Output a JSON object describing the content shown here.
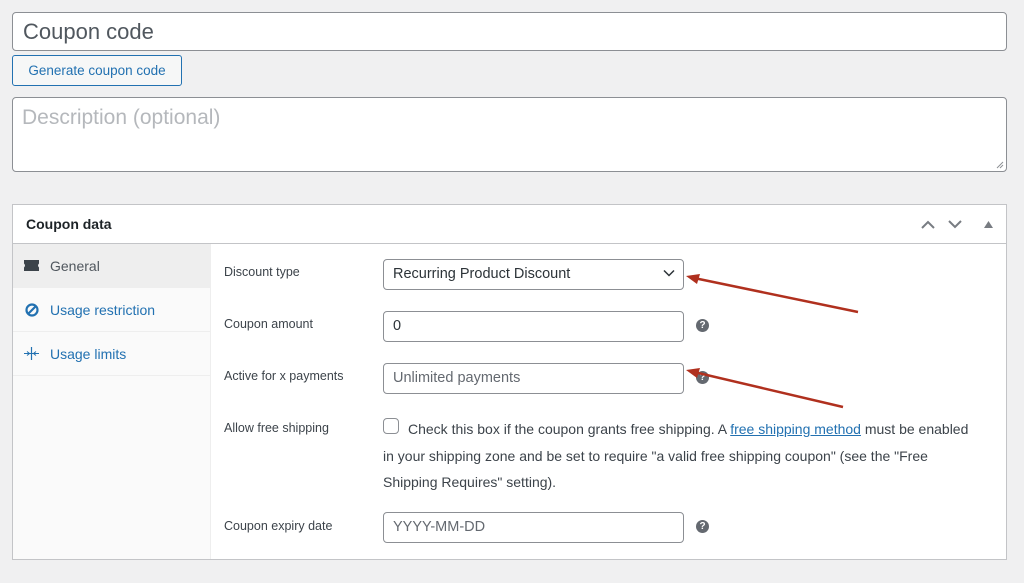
{
  "coupon_code": {
    "placeholder": "Coupon code"
  },
  "generate_button": "Generate coupon code",
  "description": {
    "placeholder": "Description (optional)"
  },
  "panel": {
    "title": "Coupon data",
    "controls": [
      "move-up",
      "move-down",
      "toggle-panel"
    ]
  },
  "tabs": [
    {
      "label": "General",
      "icon": "ticket-icon",
      "active": true
    },
    {
      "label": "Usage restriction",
      "icon": "block-icon",
      "active": false
    },
    {
      "label": "Usage limits",
      "icon": "limits-icon",
      "active": false
    }
  ],
  "fields": {
    "discount_type": {
      "label": "Discount type",
      "value": "Recurring Product Discount"
    },
    "coupon_amount": {
      "label": "Coupon amount",
      "value": "0"
    },
    "active_payments": {
      "label": "Active for x payments",
      "placeholder": "Unlimited payments"
    },
    "free_shipping": {
      "label": "Allow free shipping",
      "checked": false,
      "text_before": "Check this box if the coupon grants free shipping. A ",
      "link": "free shipping method",
      "text_after": " must be enabled in your shipping zone and be set to require \"a valid free shipping coupon\" (see the \"Free Shipping Requires\" setting)."
    },
    "expiry_date": {
      "label": "Coupon expiry date",
      "placeholder": "YYYY-MM-DD"
    }
  },
  "help_icon_glyph": "?",
  "annotation_color": "#b0301e"
}
